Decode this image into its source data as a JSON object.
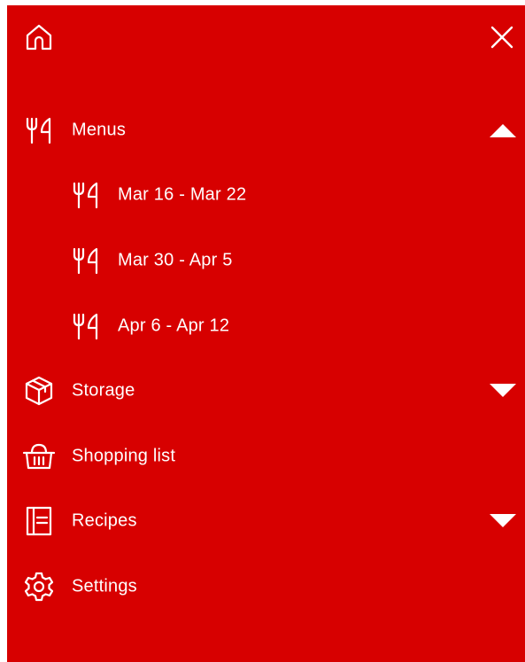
{
  "colors": {
    "panel_bg": "#d70000",
    "foreground": "#ffffff"
  },
  "topbar": {
    "home_icon": "home-icon",
    "close_icon": "close-icon"
  },
  "menu": {
    "menus": {
      "label": "Menus",
      "icon": "cutlery-icon",
      "expanded": true,
      "children": [
        {
          "label": "Mar 16 - Mar 22",
          "icon": "cutlery-icon"
        },
        {
          "label": "Mar 30 - Apr 5",
          "icon": "cutlery-icon"
        },
        {
          "label": "Apr 6 - Apr 12",
          "icon": "cutlery-icon"
        }
      ]
    },
    "storage": {
      "label": "Storage",
      "icon": "box-icon",
      "expanded": false
    },
    "shopping": {
      "label": "Shopping list",
      "icon": "basket-icon"
    },
    "recipes": {
      "label": "Recipes",
      "icon": "book-icon",
      "expanded": false
    },
    "settings": {
      "label": "Settings",
      "icon": "gear-icon"
    }
  }
}
